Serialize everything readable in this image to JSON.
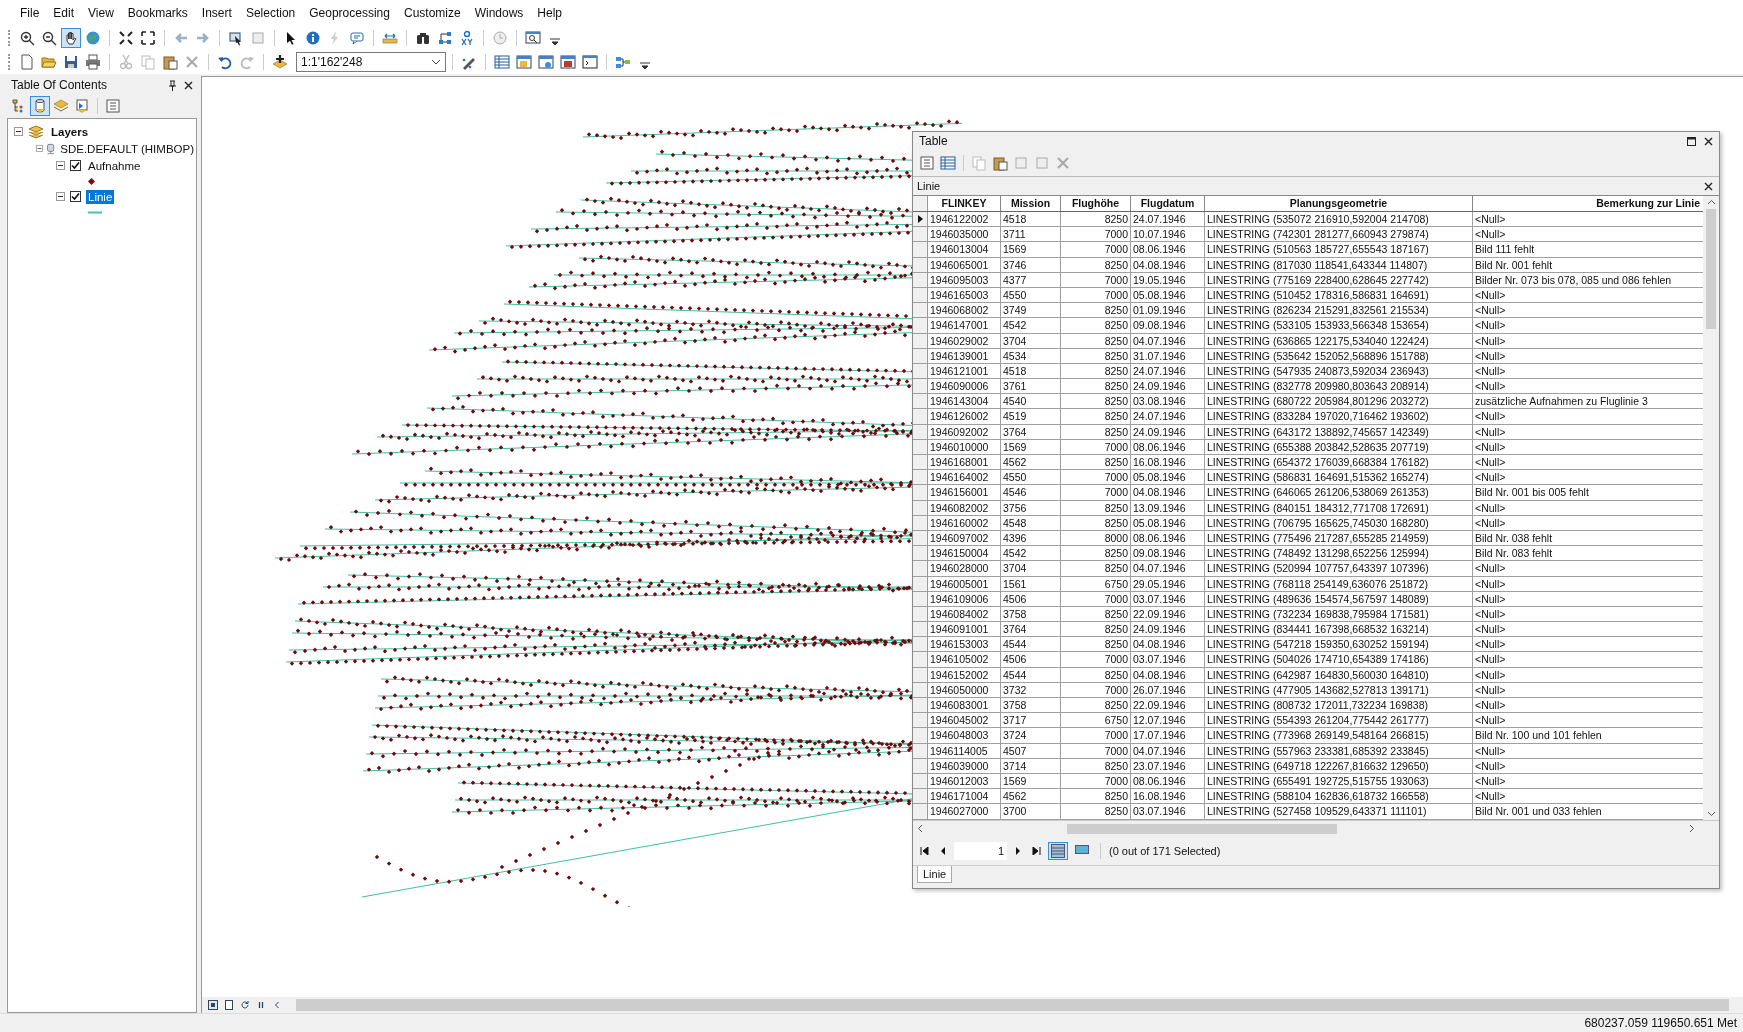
{
  "menu": [
    {
      "label": "File"
    },
    {
      "label": "Edit"
    },
    {
      "label": "View"
    },
    {
      "label": "Bookmarks"
    },
    {
      "label": "Insert"
    },
    {
      "label": "Selection"
    },
    {
      "label": "Geoprocessing"
    },
    {
      "label": "Customize"
    },
    {
      "label": "Windows"
    },
    {
      "label": "Help"
    }
  ],
  "toolbar": {
    "scale": "1:1'162'248"
  },
  "toc": {
    "title": "Table Of Contents",
    "tree": [
      {
        "label": "Layers",
        "kind": "layers",
        "expanded": true,
        "children": [
          {
            "label": "SDE.DEFAULT (HIMBOP)",
            "kind": "database",
            "expanded": true,
            "children": [
              {
                "label": "Aufnahme",
                "kind": "point_layer",
                "checked": true,
                "selected": false,
                "expanded": true
              },
              {
                "label": "Linie",
                "kind": "line_layer",
                "checked": true,
                "selected": true,
                "expanded": true
              }
            ]
          }
        ]
      }
    ]
  },
  "table_window": {
    "title": "Table",
    "table_name": "Linie",
    "columns": [
      {
        "label": "FLINKEY",
        "kind": "text"
      },
      {
        "label": "Mission",
        "kind": "text"
      },
      {
        "label": "Flughöhe",
        "kind": "number"
      },
      {
        "label": "Flugdatum",
        "kind": "text"
      },
      {
        "label": "Planungsgeometrie",
        "kind": "text"
      },
      {
        "label": "Bemerkung zur Linie",
        "kind": "text"
      }
    ],
    "rows": [
      {
        "current": true,
        "cells": [
          "1946122002",
          "4518",
          "8250",
          "24.07.1946",
          "LINESTRING (535072 216910,592004 214708)",
          "<Null>"
        ]
      },
      {
        "current": false,
        "cells": [
          "1946035000",
          "3711",
          "7000",
          "10.07.1946",
          "LINESTRING (742301 281277,660943 279874)",
          "<Null>"
        ]
      },
      {
        "current": false,
        "cells": [
          "1946013004",
          "1569",
          "7000",
          "08.06.1946",
          "LINESTRING (510563 185727,655543 187167)",
          "Bild 111 fehlt"
        ]
      },
      {
        "current": false,
        "cells": [
          "1946065001",
          "3746",
          "8250",
          "04.08.1946",
          "LINESTRING (817030 118541,643344 114807)",
          "Bild Nr. 001 fehlt"
        ]
      },
      {
        "current": false,
        "cells": [
          "1946095003",
          "4377",
          "7000",
          "19.05.1946",
          "LINESTRING (775169 228400,628645 227742)",
          "Bilder Nr. 073 bis 078, 085 und 086 fehlen"
        ]
      },
      {
        "current": false,
        "cells": [
          "1946165003",
          "4550",
          "7000",
          "05.08.1946",
          "LINESTRING (510452 178316,586831 164691)",
          "<Null>"
        ]
      },
      {
        "current": false,
        "cells": [
          "1946068002",
          "3749",
          "8250",
          "01.09.1946",
          "LINESTRING (826234 215291,832561 215534)",
          "<Null>"
        ]
      },
      {
        "current": false,
        "cells": [
          "1946147001",
          "4542",
          "8250",
          "09.08.1946",
          "LINESTRING (533105 153933,566348 153654)",
          "<Null>"
        ]
      },
      {
        "current": false,
        "cells": [
          "1946029002",
          "3704",
          "8250",
          "04.07.1946",
          "LINESTRING (636865 122175,534040 122424)",
          "<Null>"
        ]
      },
      {
        "current": false,
        "cells": [
          "1946139001",
          "4534",
          "8250",
          "31.07.1946",
          "LINESTRING (535642 152052,568896 151788)",
          "<Null>"
        ]
      },
      {
        "current": false,
        "cells": [
          "1946121001",
          "4518",
          "8250",
          "24.07.1946",
          "LINESTRING (547935 240873,592034 236943)",
          "<Null>"
        ]
      },
      {
        "current": false,
        "cells": [
          "1946090006",
          "3761",
          "8250",
          "24.09.1946",
          "LINESTRING (832778 209980,803643 208914)",
          "<Null>"
        ]
      },
      {
        "current": false,
        "cells": [
          "1946143004",
          "4540",
          "8250",
          "03.08.1946",
          "LINESTRING (680722 205984,801296 203272)",
          "zusätzliche Aufnahmen zu Fluglinie 3"
        ]
      },
      {
        "current": false,
        "cells": [
          "1946126002",
          "4519",
          "8250",
          "24.07.1946",
          "LINESTRING (833284 197020,716462 193602)",
          "<Null>"
        ]
      },
      {
        "current": false,
        "cells": [
          "1946092002",
          "3764",
          "8250",
          "24.09.1946",
          "LINESTRING (643172 138892,745657 142349)",
          "<Null>"
        ]
      },
      {
        "current": false,
        "cells": [
          "1946010000",
          "1569",
          "7000",
          "08.06.1946",
          "LINESTRING (655388 203842,528635 207719)",
          "<Null>"
        ]
      },
      {
        "current": false,
        "cells": [
          "1946168001",
          "4562",
          "8250",
          "16.08.1946",
          "LINESTRING (654372 176039,668384 176182)",
          "<Null>"
        ]
      },
      {
        "current": false,
        "cells": [
          "1946164002",
          "4550",
          "7000",
          "05.08.1946",
          "LINESTRING (586831 164691,515362 165274)",
          "<Null>"
        ]
      },
      {
        "current": false,
        "cells": [
          "1946156001",
          "4546",
          "7000",
          "04.08.1946",
          "LINESTRING (646065 261206,538069 261353)",
          "Bild Nr. 001 bis 005 fehlt"
        ]
      },
      {
        "current": false,
        "cells": [
          "1946082002",
          "3756",
          "8250",
          "13.09.1946",
          "LINESTRING (840151 184312,771708 172691)",
          "<Null>"
        ]
      },
      {
        "current": false,
        "cells": [
          "1946160002",
          "4548",
          "8250",
          "05.08.1946",
          "LINESTRING (706795 165625,745030 168280)",
          "<Null>"
        ]
      },
      {
        "current": false,
        "cells": [
          "1946097002",
          "4396",
          "8000",
          "08.06.1946",
          "LINESTRING (775496 217287,655285 214959)",
          "Bild Nr. 038 fehlt"
        ]
      },
      {
        "current": false,
        "cells": [
          "1946150004",
          "4542",
          "8250",
          "09.08.1946",
          "LINESTRING (748492 131298,652256 125994)",
          "Bild Nr. 083 fehlt"
        ]
      },
      {
        "current": false,
        "cells": [
          "1946028000",
          "3704",
          "8250",
          "04.07.1946",
          "LINESTRING (520994 107757,643397 107396)",
          "<Null>"
        ]
      },
      {
        "current": false,
        "cells": [
          "1946005001",
          "1561",
          "6750",
          "29.05.1946",
          "LINESTRING (768118 254149,636076 251872)",
          "<Null>"
        ]
      },
      {
        "current": false,
        "cells": [
          "1946109006",
          "4506",
          "7000",
          "03.07.1946",
          "LINESTRING (489636 154574,567597 148089)",
          "<Null>"
        ]
      },
      {
        "current": false,
        "cells": [
          "1946084002",
          "3758",
          "8250",
          "22.09.1946",
          "LINESTRING (732234 169838,795984 171581)",
          "<Null>"
        ]
      },
      {
        "current": false,
        "cells": [
          "1946091001",
          "3764",
          "8250",
          "24.09.1946",
          "LINESTRING (834441 167398,668532 163214)",
          "<Null>"
        ]
      },
      {
        "current": false,
        "cells": [
          "1946153003",
          "4544",
          "8250",
          "04.08.1946",
          "LINESTRING (547218 159350,630252 159194)",
          "<Null>"
        ]
      },
      {
        "current": false,
        "cells": [
          "1946105002",
          "4506",
          "7000",
          "03.07.1946",
          "LINESTRING (504026 174710,654389 174186)",
          "<Null>"
        ]
      },
      {
        "current": false,
        "cells": [
          "1946152002",
          "4544",
          "8250",
          "04.08.1946",
          "LINESTRING (642987 164830,560030 164810)",
          "<Null>"
        ]
      },
      {
        "current": false,
        "cells": [
          "1946050000",
          "3732",
          "7000",
          "26.07.1946",
          "LINESTRING (477905 143682,527813 139171)",
          "<Null>"
        ]
      },
      {
        "current": false,
        "cells": [
          "1946083001",
          "3758",
          "8250",
          "22.09.1946",
          "LINESTRING (808732 172011,732234 169838)",
          "<Null>"
        ]
      },
      {
        "current": false,
        "cells": [
          "1946045002",
          "3717",
          "6750",
          "12.07.1946",
          "LINESTRING (554393 261204,775442 261777)",
          "<Null>"
        ]
      },
      {
        "current": false,
        "cells": [
          "1946048003",
          "3724",
          "7000",
          "17.07.1946",
          "LINESTRING (773968 269149,548164 266815)",
          "Bild Nr. 100 und 101 fehlen"
        ]
      },
      {
        "current": false,
        "cells": [
          "1946114005",
          "4507",
          "7000",
          "04.07.1946",
          "LINESTRING (557963 233381,685392 233845)",
          "<Null>"
        ]
      },
      {
        "current": false,
        "cells": [
          "1946039000",
          "3714",
          "8250",
          "23.07.1946",
          "LINESTRING (649718 122267,816632 129650)",
          "<Null>"
        ]
      },
      {
        "current": false,
        "cells": [
          "1946012003",
          "1569",
          "7000",
          "08.06.1946",
          "LINESTRING (655491 192725,515755 193063)",
          "<Null>"
        ]
      },
      {
        "current": false,
        "cells": [
          "1946171004",
          "4562",
          "8250",
          "16.08.1946",
          "LINESTRING (588104 162836,618732 166558)",
          "<Null>"
        ]
      },
      {
        "current": false,
        "cells": [
          "1946027000",
          "3700",
          "8250",
          "03.07.1946",
          "LINESTRING (527458 109529,643371 111101)",
          "Bild Nr. 001 und 033 fehlen"
        ]
      }
    ],
    "navigation": {
      "record": "1",
      "status": "(0 out of 171 Selected)"
    },
    "tabs": [
      {
        "label": "Linie",
        "selected": true
      }
    ]
  },
  "status_bar": {
    "coordinates": "680237.059  119650.651 Met"
  }
}
